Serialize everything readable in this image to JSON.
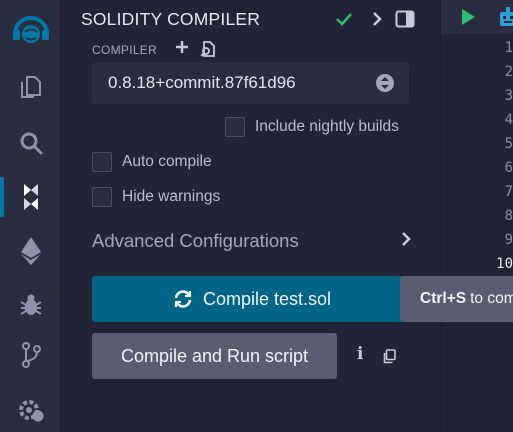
{
  "panel": {
    "title": "SOLIDITY COMPILER",
    "compiler_label": "COMPILER",
    "selected_version": "0.8.18+commit.87f61d96",
    "include_nightly_label": "Include nightly builds",
    "auto_compile_label": "Auto compile",
    "hide_warnings_label": "Hide warnings",
    "advanced_label": "Advanced Configurations",
    "compile_button_label": "Compile test.sol",
    "compile_run_button_label": "Compile and Run script",
    "info_label": "i"
  },
  "tooltip": {
    "shortcut": "Ctrl+S",
    "text": "to compile test.sol"
  },
  "editor": {
    "line_numbers": [
      "1",
      "2",
      "3",
      "4",
      "5",
      "6",
      "7",
      "8",
      "9",
      "10"
    ],
    "current_line": "10"
  },
  "icons": {
    "rail": [
      "remix-logo-icon",
      "file-explorer-icon",
      "search-icon",
      "solidity-compiler-icon",
      "deploy-run-icon",
      "debugger-icon",
      "git-icon",
      "settings-icon"
    ],
    "header": [
      "check-icon",
      "chevron-right-icon",
      "panel-toggle-icon"
    ],
    "editor": [
      "run-play-icon",
      "ai-bot-icon"
    ]
  },
  "colors": {
    "accent": "#007aa6",
    "compile_button": "#006486",
    "success": "#2fbf71",
    "panel_bg": "#222336",
    "rail_bg": "#2a2c3f"
  }
}
